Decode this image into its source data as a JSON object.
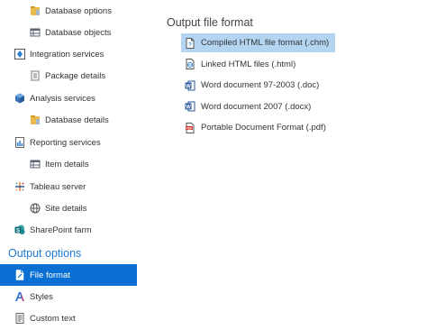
{
  "sidebar": {
    "items": [
      {
        "label": "Database options",
        "icon": "database-options-icon"
      },
      {
        "label": "Database objects",
        "icon": "database-objects-icon"
      },
      {
        "label": "Integration services",
        "icon": "integration-services-icon"
      },
      {
        "label": "Package details",
        "icon": "package-details-icon"
      },
      {
        "label": "Analysis services",
        "icon": "analysis-services-icon"
      },
      {
        "label": "Database details",
        "icon": "database-details-icon"
      },
      {
        "label": "Reporting services",
        "icon": "reporting-services-icon"
      },
      {
        "label": "Item details",
        "icon": "item-details-icon"
      },
      {
        "label": "Tableau server",
        "icon": "tableau-server-icon"
      },
      {
        "label": "Site details",
        "icon": "site-details-icon"
      },
      {
        "label": "SharePoint farm",
        "icon": "sharepoint-farm-icon"
      }
    ],
    "output_section_title": "Output options",
    "output_items": [
      {
        "label": "File format",
        "icon": "file-format-icon",
        "selected": true
      },
      {
        "label": "Styles",
        "icon": "styles-icon"
      },
      {
        "label": "Custom text",
        "icon": "custom-text-icon"
      }
    ]
  },
  "main": {
    "title": "Output file format",
    "formats": [
      {
        "label": "Compiled HTML file format (.chm)",
        "icon": "chm-file-icon",
        "selected": true
      },
      {
        "label": "Linked HTML files (.html)",
        "icon": "html-file-icon"
      },
      {
        "label": "Word document 97-2003 (.doc)",
        "icon": "word-doc-icon"
      },
      {
        "label": "Word document 2007 (.docx)",
        "icon": "word-docx-icon"
      },
      {
        "label": "Portable Document Format (.pdf)",
        "icon": "pdf-file-icon"
      }
    ]
  },
  "colors": {
    "accent": "#0a6fd2",
    "section_title": "#1f79d1",
    "format_selected_bg": "#b3d5f2"
  }
}
